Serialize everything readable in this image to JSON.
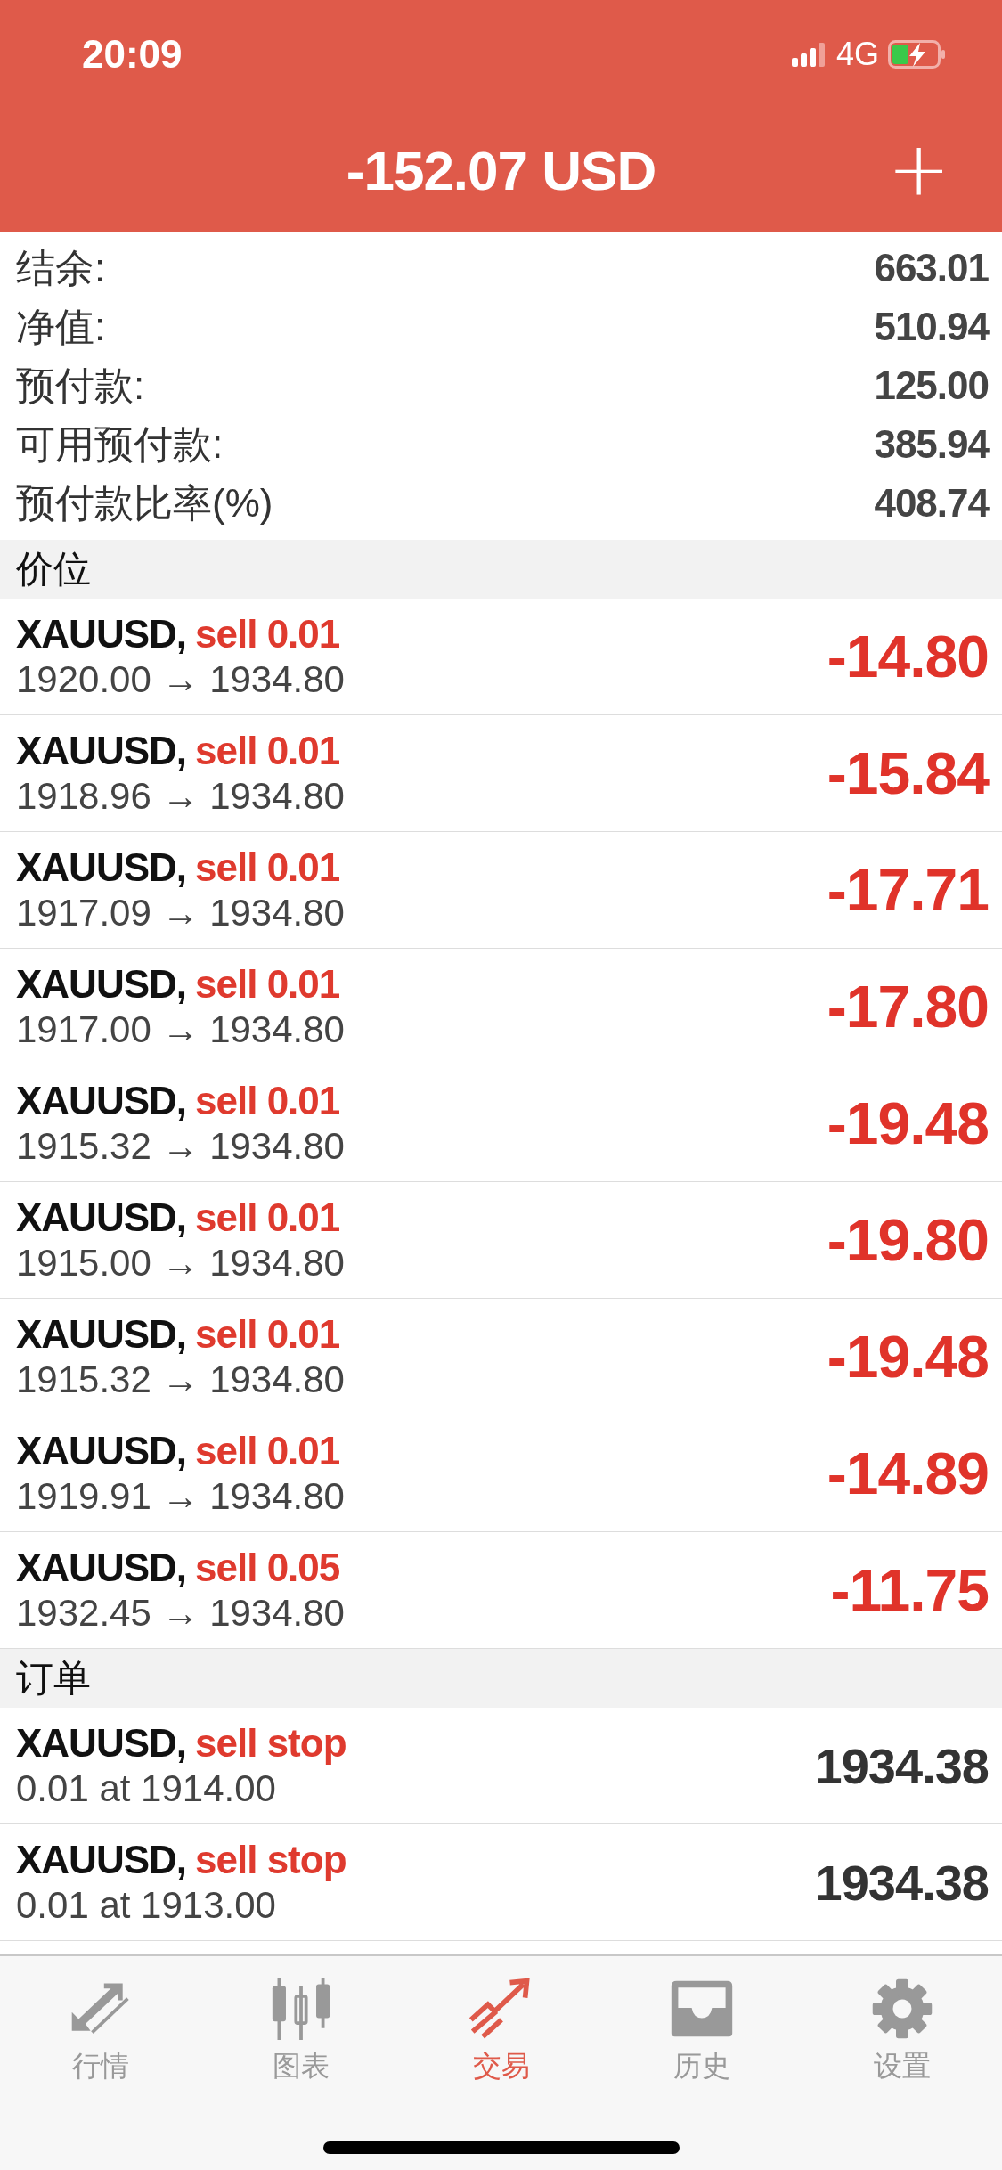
{
  "status_bar": {
    "time": "20:09",
    "network": "4G"
  },
  "header": {
    "title": "-152.07 USD",
    "add": "+"
  },
  "summary": [
    {
      "label": "结余:",
      "value": "663.01"
    },
    {
      "label": "净值:",
      "value": "510.94"
    },
    {
      "label": "预付款:",
      "value": "125.00"
    },
    {
      "label": "可用预付款:",
      "value": "385.94"
    },
    {
      "label": "预付款比率(%)",
      "value": "408.74"
    }
  ],
  "positions_title": "价位",
  "positions": [
    {
      "symbol": "XAUUSD,",
      "side": "sell 0.01",
      "prices": "1920.00 → 1934.80",
      "profit": "-14.80"
    },
    {
      "symbol": "XAUUSD,",
      "side": "sell 0.01",
      "prices": "1918.96 → 1934.80",
      "profit": "-15.84"
    },
    {
      "symbol": "XAUUSD,",
      "side": "sell 0.01",
      "prices": "1917.09 → 1934.80",
      "profit": "-17.71"
    },
    {
      "symbol": "XAUUSD,",
      "side": "sell 0.01",
      "prices": "1917.00 → 1934.80",
      "profit": "-17.80"
    },
    {
      "symbol": "XAUUSD,",
      "side": "sell 0.01",
      "prices": "1915.32 → 1934.80",
      "profit": "-19.48"
    },
    {
      "symbol": "XAUUSD,",
      "side": "sell 0.01",
      "prices": "1915.00 → 1934.80",
      "profit": "-19.80"
    },
    {
      "symbol": "XAUUSD,",
      "side": "sell 0.01",
      "prices": "1915.32 → 1934.80",
      "profit": "-19.48"
    },
    {
      "symbol": "XAUUSD,",
      "side": "sell 0.01",
      "prices": "1919.91 → 1934.80",
      "profit": "-14.89"
    },
    {
      "symbol": "XAUUSD,",
      "side": "sell 0.05",
      "prices": "1932.45 → 1934.80",
      "profit": "-11.75"
    }
  ],
  "orders_title": "订单",
  "orders": [
    {
      "symbol": "XAUUSD,",
      "side": "sell stop",
      "detail": "0.01 at 1914.00",
      "price": "1934.38"
    },
    {
      "symbol": "XAUUSD,",
      "side": "sell stop",
      "detail": "0.01 at 1913.00",
      "price": "1934.38"
    }
  ],
  "tabs": [
    {
      "kind": "quotes",
      "label": "行情",
      "selected": false
    },
    {
      "kind": "chart",
      "label": "图表",
      "selected": false
    },
    {
      "kind": "trade",
      "label": "交易",
      "selected": true
    },
    {
      "kind": "history",
      "label": "历史",
      "selected": false
    },
    {
      "kind": "settings",
      "label": "设置",
      "selected": false
    }
  ]
}
